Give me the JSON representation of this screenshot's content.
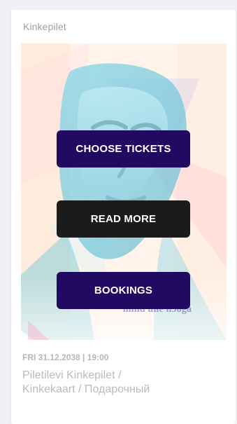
{
  "card": {
    "top_label": "Kinkepilet"
  },
  "poster": {
    "caption": "mind une n3oga",
    "buttons": [
      {
        "label": "CHOOSE TICKETS",
        "style": "primary"
      },
      {
        "label": "READ MORE",
        "style": "secondary"
      },
      {
        "label": "BOOKINGS",
        "style": "primary"
      }
    ]
  },
  "event": {
    "date_time": "FRI 31.12.2038 | 19:00",
    "title_line1": "Piletilevi Kinkepilet /",
    "title_line2": "Kinkekaart / Подарочный"
  },
  "colors": {
    "primary_button": "#220a63",
    "secondary_button": "#1b1b1b",
    "muted_text": "#b7bcc2",
    "page_background": "#eef0f3"
  }
}
